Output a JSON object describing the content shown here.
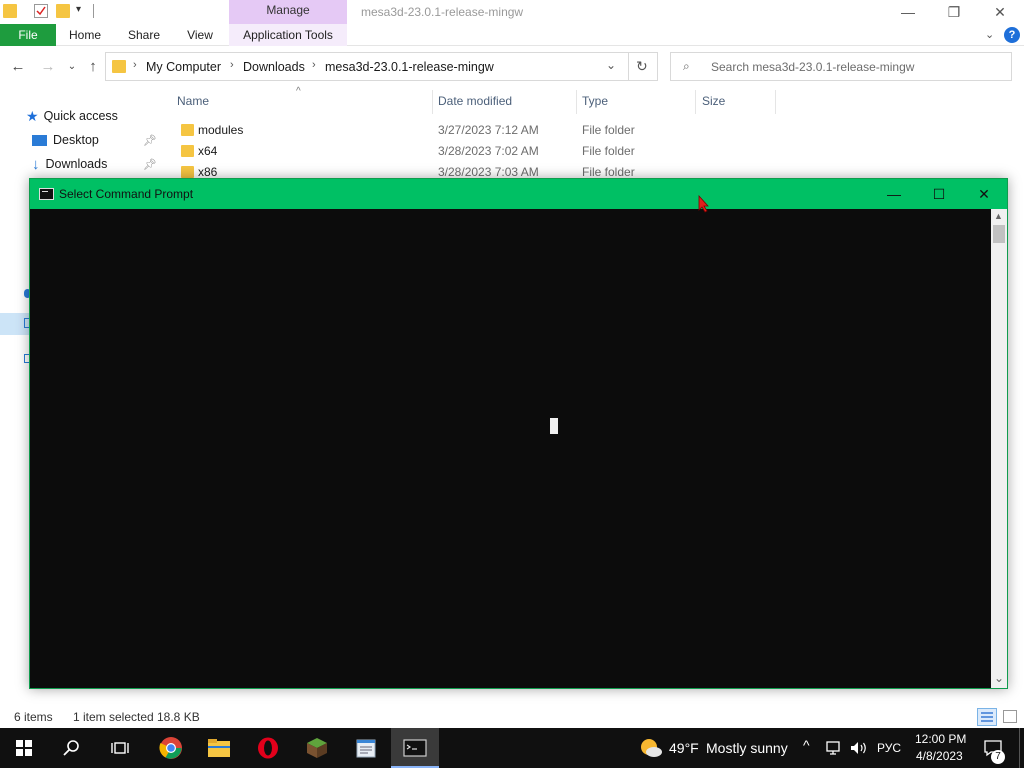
{
  "explorer": {
    "window_title": "mesa3d-23.0.1-release-mingw",
    "ribbon": {
      "file_tab": "File",
      "home_tab": "Home",
      "share_tab": "Share",
      "view_tab": "View",
      "context_header": "Manage",
      "app_tools_tab": "Application Tools"
    },
    "address": {
      "crumbs": [
        "My Computer",
        "Downloads",
        "mesa3d-23.0.1-release-mingw"
      ],
      "search_placeholder": "Search mesa3d-23.0.1-release-mingw"
    },
    "nav_pane": {
      "quick_access": "Quick access",
      "items": [
        {
          "label": "Desktop",
          "pinned": true
        },
        {
          "label": "Downloads",
          "pinned": true
        }
      ]
    },
    "columns": {
      "name": "Name",
      "date_modified": "Date modified",
      "type": "Type",
      "size": "Size"
    },
    "files": [
      {
        "name": "modules",
        "date": "3/27/2023 7:12 AM",
        "type": "File folder"
      },
      {
        "name": "x64",
        "date": "3/28/2023 7:02 AM",
        "type": "File folder"
      },
      {
        "name": "x86",
        "date": "3/28/2023 7:03 AM",
        "type": "File folder"
      }
    ],
    "status": {
      "item_count": "6 items",
      "selection": "1 item selected",
      "selection_size": "18.8 KB"
    }
  },
  "cmd": {
    "title": "Select Command Prompt",
    "titlebar_color": "#00c064"
  },
  "taskbar": {
    "apps": [
      "start",
      "search",
      "task-view",
      "chrome",
      "file-explorer",
      "opera",
      "minecraft",
      "notepad",
      "command-prompt"
    ],
    "weather": {
      "temp": "49°F",
      "condition": "Mostly sunny"
    },
    "language": "РУС",
    "time": "12:00 PM",
    "date": "4/8/2023",
    "notification_count": "7"
  },
  "colors": {
    "accent_green": "#1e9c3e",
    "manage_purple": "#e5c9f5"
  }
}
